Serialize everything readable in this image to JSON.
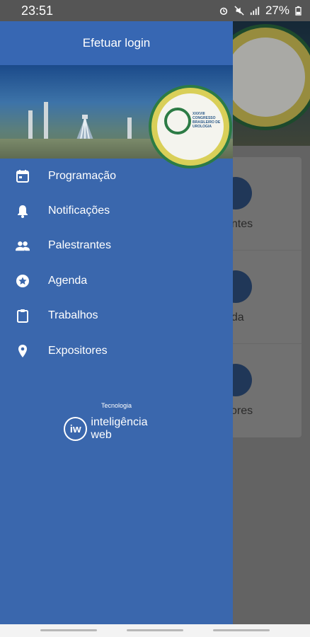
{
  "status_bar": {
    "time": "23:51",
    "battery": "27%",
    "icons": [
      "alarm-icon",
      "mute-icon",
      "signal-icon",
      "battery-icon"
    ]
  },
  "drawer": {
    "login_label": "Efetuar login",
    "menu": [
      {
        "label": "Programação",
        "icon": "calendar-icon"
      },
      {
        "label": "Notificações",
        "icon": "bell-icon"
      },
      {
        "label": "Palestrantes",
        "icon": "people-icon"
      },
      {
        "label": "Agenda",
        "icon": "star-icon"
      },
      {
        "label": "Trabalhos",
        "icon": "clipboard-icon"
      },
      {
        "label": "Expositores",
        "icon": "location-pin-icon"
      }
    ],
    "tech_label": "Tecnologia",
    "brand_name": "inteligência web",
    "brand_initials": "iw",
    "logo_text": "XXXVIII CONGRESSO BRASILEIRO DE UROLOGIA"
  },
  "background": {
    "rows": [
      "antes",
      "nda",
      "itores"
    ]
  },
  "colors": {
    "drawer": "#3a67ad",
    "header": "#3767b3",
    "text": "#ffffff"
  }
}
